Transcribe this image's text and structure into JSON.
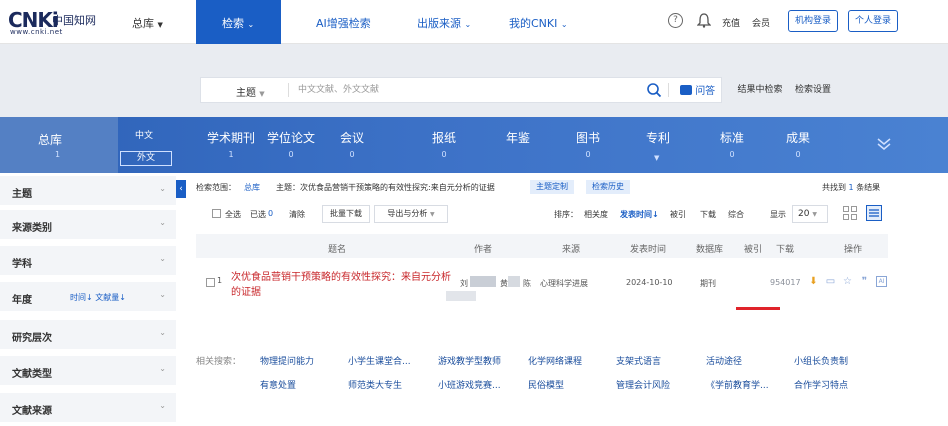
{
  "header": {
    "logo_mark": "CNKi",
    "logo_cn": "中国知网",
    "logo_url": "www.cnki.net",
    "total_lib": "总库",
    "nav": [
      "检索",
      "AI增强检索",
      "出版来源",
      "我的CNKI"
    ],
    "help": "?",
    "recharge": "充值",
    "member": "会员",
    "org_login": "机构登录",
    "personal_login": "个人登录"
  },
  "search": {
    "field": "主题",
    "placeholder": "中文文献、外文文献",
    "ask": "问答",
    "in_result": "结果中检索",
    "settings": "检索设置"
  },
  "categories": {
    "total": "总库",
    "total_count": "1",
    "chinese": "中文",
    "foreign": "外文",
    "items": [
      {
        "label": "学术期刊",
        "count": "1"
      },
      {
        "label": "学位论文",
        "count": "0"
      },
      {
        "label": "会议",
        "count": "0"
      },
      {
        "label": "报纸",
        "count": "0"
      },
      {
        "label": "年鉴",
        "count": ""
      },
      {
        "label": "图书",
        "count": "0"
      },
      {
        "label": "专利",
        "count": ""
      },
      {
        "label": "标准",
        "count": "0"
      },
      {
        "label": "成果",
        "count": "0"
      }
    ]
  },
  "sidebar": {
    "items": [
      {
        "label": "主题"
      },
      {
        "label": "来源类别"
      },
      {
        "label": "学科"
      },
      {
        "label": "年度",
        "extra": "时间↓ 文献量↓"
      },
      {
        "label": "研究层次"
      },
      {
        "label": "文献类型"
      },
      {
        "label": "文献来源"
      }
    ]
  },
  "results": {
    "scope_label": "检索范围：",
    "scope_value": "总库",
    "query": "主题：次优食品营销干预策略的有效性探究:来自元分析的证据",
    "tag_custom": "主题定制",
    "tag_history": "检索历史",
    "found_prefix": "共找到",
    "found_count": "1",
    "found_suffix": "条结果",
    "select_all": "全选",
    "selected_label": "已选",
    "selected_count": "0",
    "clear": "清除",
    "batch_download": "批量下载",
    "export": "导出与分析",
    "sort_label": "排序：",
    "sort_relevance": "相关度",
    "sort_date": "发表时间↓",
    "sort_cited": "被引",
    "sort_download": "下载",
    "sort_overall": "综合",
    "display_label": "显示",
    "display_count": "20",
    "columns": [
      "题名",
      "作者",
      "来源",
      "发表时间",
      "数据库",
      "被引",
      "下载",
      "操作"
    ],
    "row": {
      "title": "次优食品营销干预策略的有效性探究：来自元分析的证据",
      "author1": "刘",
      "author2": "黄",
      "author3": "陈",
      "source": "心理科学进展",
      "date": "2024-10-10",
      "database": "期刊",
      "downloads": "954017",
      "icons": [
        "download-icon",
        "read-icon",
        "favorite-icon",
        "quote-icon",
        "ai-icon"
      ]
    }
  },
  "related": {
    "label": "相关搜索：",
    "terms": [
      "物理提问能力",
      "小学生课堂合...",
      "游戏教学型教师",
      "化学网络课程",
      "支架式语言",
      "活动途径",
      "小组长负责制",
      "有意处置",
      "师范类大专生",
      "小班游戏竞赛...",
      "民俗模型",
      "管理会计风险",
      "《学前教育学...",
      "合作学习特点"
    ]
  },
  "colors": {
    "primary": "#1a5ec5",
    "title_red": "#c8272b",
    "highlight": "#e0232a"
  }
}
